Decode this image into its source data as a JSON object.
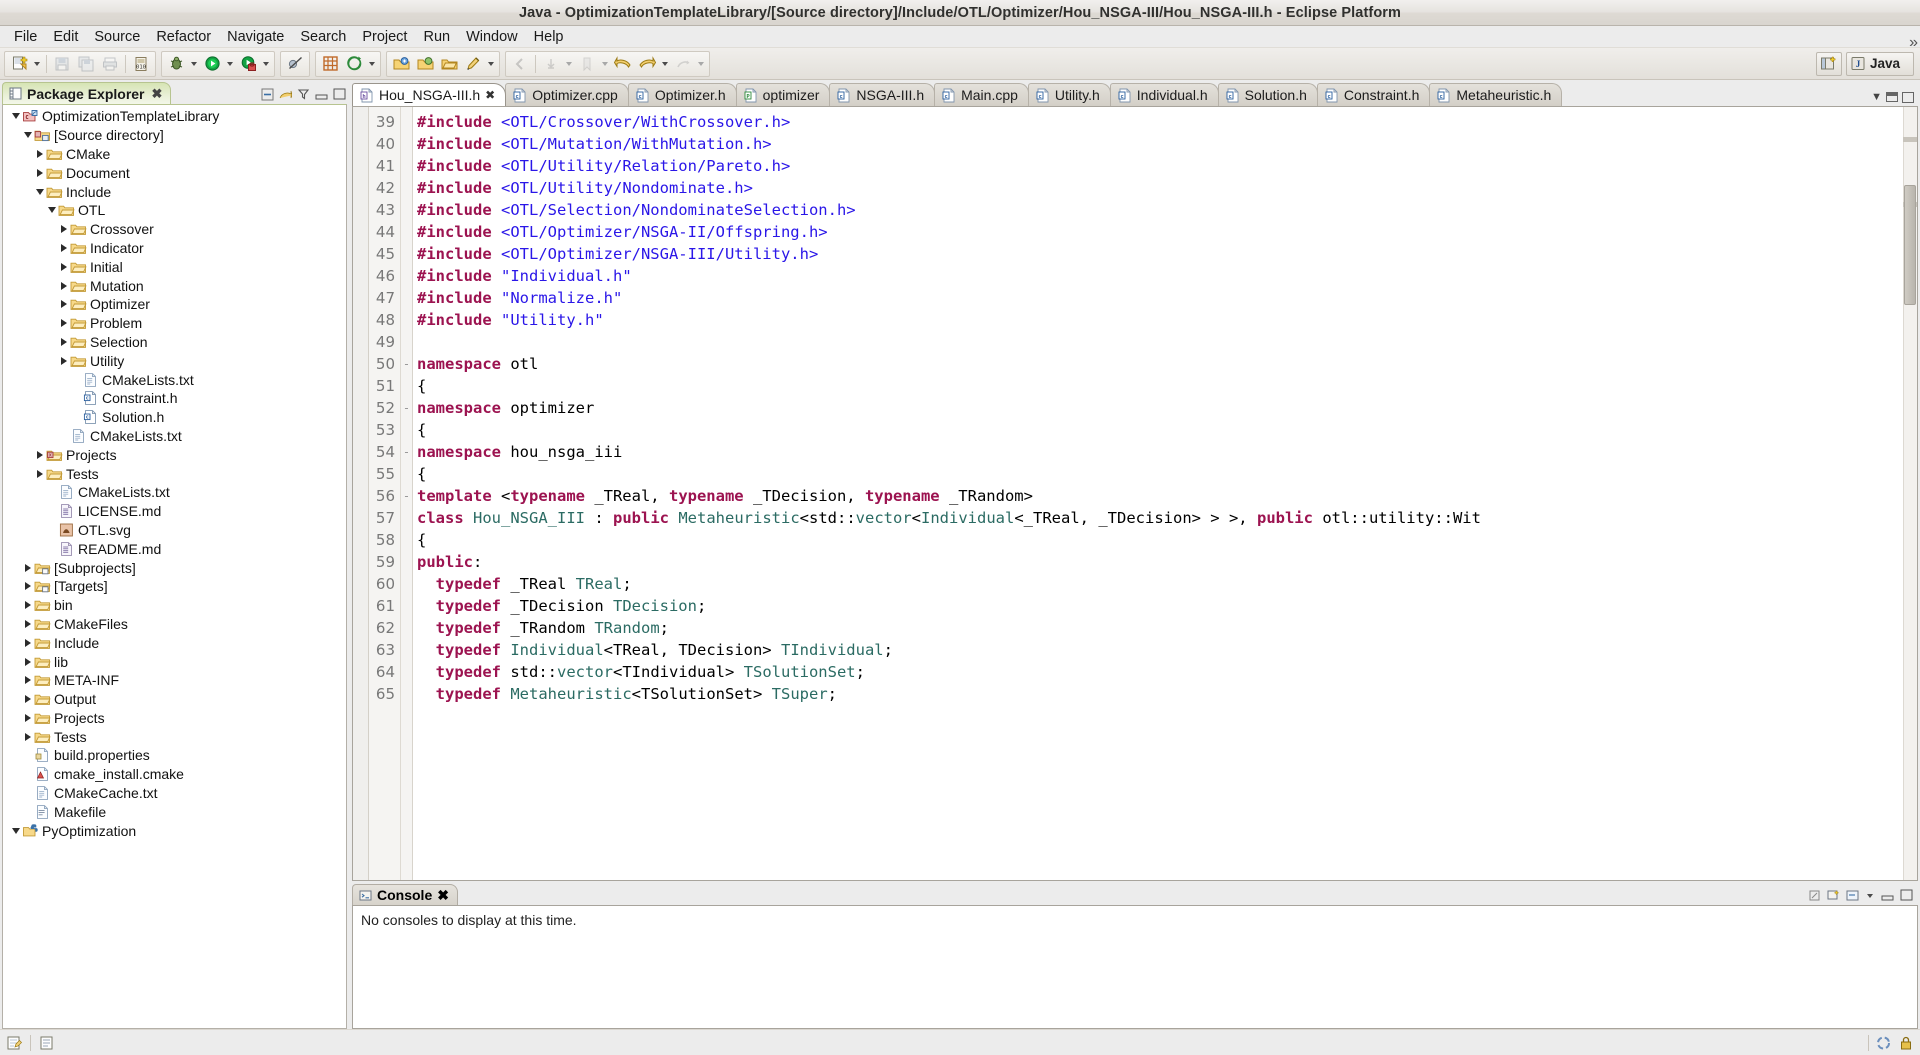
{
  "window": {
    "title": "Java - OptimizationTemplateLibrary/[Source directory]/Include/OTL/Optimizer/Hou_NSGA-III/Hou_NSGA-III.h - Eclipse Platform"
  },
  "menubar": {
    "items": [
      "File",
      "Edit",
      "Source",
      "Refactor",
      "Navigate",
      "Search",
      "Project",
      "Run",
      "Window",
      "Help"
    ]
  },
  "toolbar": {
    "perspective_label": "Java",
    "groups": [
      {
        "name": "file-group",
        "buttons": [
          "new-wizard-icon",
          "new-dropdown",
          "save-icon",
          "save-all-icon",
          "print-icon",
          "build-icon"
        ]
      },
      {
        "name": "debug-group",
        "buttons": [
          "debug-icon",
          "debug-dropdown",
          "run-icon",
          "run-dropdown",
          "external-tools-icon",
          "external-tools-dropdown"
        ]
      },
      {
        "name": "skip-group",
        "buttons": [
          "skip-breakpoints-icon"
        ]
      },
      {
        "name": "search-group",
        "buttons": [
          "new-class-icon",
          "search-icon",
          "search-dropdown"
        ]
      },
      {
        "name": "nav-group",
        "buttons": [
          "open-type-icon",
          "open-task-icon",
          "open-resource-icon",
          "marker-icon",
          "marker-dropdown"
        ]
      },
      {
        "name": "history-group",
        "buttons": [
          "prev-annotation-icon",
          "next-annotation-icon",
          "annotation-dropdown",
          "back-icon",
          "forward-icon",
          "forward-dropdown",
          "last-edit-icon",
          "last-edit-dropdown"
        ]
      }
    ]
  },
  "package_explorer": {
    "tab_label": "Package Explorer",
    "tools": [
      "collapse-all-icon",
      "link-editor-icon",
      "view-filter-icon",
      "minimize-icon",
      "maximize-icon"
    ],
    "tree": [
      {
        "label": "OptimizationTemplateLibrary",
        "indent": 0,
        "twisty": "down",
        "icon": "cproject-icon"
      },
      {
        "label": "[Source directory]",
        "indent": 1,
        "twisty": "down",
        "icon": "source-folder-icon"
      },
      {
        "label": "CMake",
        "indent": 2,
        "twisty": "right",
        "icon": "folder-icon"
      },
      {
        "label": "Document",
        "indent": 2,
        "twisty": "right",
        "icon": "folder-icon"
      },
      {
        "label": "Include",
        "indent": 2,
        "twisty": "down",
        "icon": "folder-icon"
      },
      {
        "label": "OTL",
        "indent": 3,
        "twisty": "down",
        "icon": "folder-icon"
      },
      {
        "label": "Crossover",
        "indent": 4,
        "twisty": "right",
        "icon": "folder-icon"
      },
      {
        "label": "Indicator",
        "indent": 4,
        "twisty": "right",
        "icon": "folder-icon"
      },
      {
        "label": "Initial",
        "indent": 4,
        "twisty": "right",
        "icon": "folder-icon"
      },
      {
        "label": "Mutation",
        "indent": 4,
        "twisty": "right",
        "icon": "folder-icon"
      },
      {
        "label": "Optimizer",
        "indent": 4,
        "twisty": "right",
        "icon": "folder-icon"
      },
      {
        "label": "Problem",
        "indent": 4,
        "twisty": "right",
        "icon": "folder-icon"
      },
      {
        "label": "Selection",
        "indent": 4,
        "twisty": "right",
        "icon": "folder-icon"
      },
      {
        "label": "Utility",
        "indent": 4,
        "twisty": "right",
        "icon": "folder-icon"
      },
      {
        "label": "CMakeLists.txt",
        "indent": 5,
        "twisty": "none",
        "icon": "text-file-icon"
      },
      {
        "label": "Constraint.h",
        "indent": 5,
        "twisty": "none",
        "icon": "c-header-icon"
      },
      {
        "label": "Solution.h",
        "indent": 5,
        "twisty": "none",
        "icon": "c-header-icon"
      },
      {
        "label": "CMakeLists.txt",
        "indent": 4,
        "twisty": "none",
        "icon": "text-file-icon"
      },
      {
        "label": "Projects",
        "indent": 2,
        "twisty": "right",
        "icon": "folder-red-icon"
      },
      {
        "label": "Tests",
        "indent": 2,
        "twisty": "right",
        "icon": "folder-icon"
      },
      {
        "label": "CMakeLists.txt",
        "indent": 3,
        "twisty": "none",
        "icon": "text-file-icon"
      },
      {
        "label": "LICENSE.md",
        "indent": 3,
        "twisty": "none",
        "icon": "md-file-icon"
      },
      {
        "label": "OTL.svg",
        "indent": 3,
        "twisty": "none",
        "icon": "svg-file-icon"
      },
      {
        "label": "README.md",
        "indent": 3,
        "twisty": "none",
        "icon": "md-file-icon"
      },
      {
        "label": "[Subprojects]",
        "indent": 1,
        "twisty": "right",
        "icon": "subproject-icon"
      },
      {
        "label": "[Targets]",
        "indent": 1,
        "twisty": "right",
        "icon": "subproject-icon"
      },
      {
        "label": "bin",
        "indent": 1,
        "twisty": "right",
        "icon": "folder-icon"
      },
      {
        "label": "CMakeFiles",
        "indent": 1,
        "twisty": "right",
        "icon": "folder-icon"
      },
      {
        "label": "Include",
        "indent": 1,
        "twisty": "right",
        "icon": "folder-icon"
      },
      {
        "label": "lib",
        "indent": 1,
        "twisty": "right",
        "icon": "folder-icon"
      },
      {
        "label": "META-INF",
        "indent": 1,
        "twisty": "right",
        "icon": "folder-icon"
      },
      {
        "label": "Output",
        "indent": 1,
        "twisty": "right",
        "icon": "folder-icon"
      },
      {
        "label": "Projects",
        "indent": 1,
        "twisty": "right",
        "icon": "folder-icon"
      },
      {
        "label": "Tests",
        "indent": 1,
        "twisty": "right",
        "icon": "folder-icon"
      },
      {
        "label": "build.properties",
        "indent": 1,
        "twisty": "none",
        "icon": "props-file-icon"
      },
      {
        "label": "cmake_install.cmake",
        "indent": 1,
        "twisty": "none",
        "icon": "cmake-file-icon"
      },
      {
        "label": "CMakeCache.txt",
        "indent": 1,
        "twisty": "none",
        "icon": "text-file-icon"
      },
      {
        "label": "Makefile",
        "indent": 1,
        "twisty": "none",
        "icon": "make-file-icon"
      },
      {
        "label": "PyOptimization",
        "indent": 0,
        "twisty": "down",
        "icon": "pyproject-icon"
      }
    ]
  },
  "editor": {
    "tabs": [
      {
        "label": "Hou_NSGA-III.h",
        "icon": "h-file-icon",
        "active": true,
        "closable": true
      },
      {
        "label": "Optimizer.cpp",
        "icon": "c-file-icon",
        "active": false,
        "closable": false
      },
      {
        "label": "Optimizer.h",
        "icon": "c-file-icon",
        "active": false,
        "closable": false
      },
      {
        "label": "optimizer",
        "icon": "py-file-icon",
        "active": false,
        "closable": false
      },
      {
        "label": "NSGA-III.h",
        "icon": "c-file-icon",
        "active": false,
        "closable": false
      },
      {
        "label": "Main.cpp",
        "icon": "c-file-icon",
        "active": false,
        "closable": false
      },
      {
        "label": "Utility.h",
        "icon": "c-file-icon",
        "active": false,
        "closable": false
      },
      {
        "label": "Individual.h",
        "icon": "c-file-icon",
        "active": false,
        "closable": false
      },
      {
        "label": "Solution.h",
        "icon": "c-file-icon",
        "active": false,
        "closable": false
      },
      {
        "label": "Constraint.h",
        "icon": "c-file-icon",
        "active": false,
        "closable": false
      },
      {
        "label": "Metaheuristic.h",
        "icon": "c-file-icon",
        "active": false,
        "closable": false
      }
    ],
    "first_line_number": 39,
    "lines": [
      {
        "n": 39,
        "fold": "",
        "tokens": [
          [
            "k",
            "#include"
          ],
          [
            "p",
            " "
          ],
          [
            "s",
            "<OTL/Crossover/WithCrossover.h>"
          ]
        ]
      },
      {
        "n": 40,
        "fold": "",
        "tokens": [
          [
            "k",
            "#include"
          ],
          [
            "p",
            " "
          ],
          [
            "s",
            "<OTL/Mutation/WithMutation.h>"
          ]
        ]
      },
      {
        "n": 41,
        "fold": "",
        "tokens": [
          [
            "k",
            "#include"
          ],
          [
            "p",
            " "
          ],
          [
            "s",
            "<OTL/Utility/Relation/Pareto.h>"
          ]
        ]
      },
      {
        "n": 42,
        "fold": "",
        "tokens": [
          [
            "k",
            "#include"
          ],
          [
            "p",
            " "
          ],
          [
            "s",
            "<OTL/Utility/Nondominate.h>"
          ]
        ]
      },
      {
        "n": 43,
        "fold": "",
        "tokens": [
          [
            "k",
            "#include"
          ],
          [
            "p",
            " "
          ],
          [
            "s",
            "<OTL/Selection/NondominateSelection.h>"
          ]
        ]
      },
      {
        "n": 44,
        "fold": "",
        "tokens": [
          [
            "k",
            "#include"
          ],
          [
            "p",
            " "
          ],
          [
            "s",
            "<OTL/Optimizer/NSGA-II/Offspring.h>"
          ]
        ]
      },
      {
        "n": 45,
        "fold": "",
        "tokens": [
          [
            "k",
            "#include"
          ],
          [
            "p",
            " "
          ],
          [
            "s",
            "<OTL/Optimizer/NSGA-III/Utility.h>"
          ]
        ]
      },
      {
        "n": 46,
        "fold": "",
        "tokens": [
          [
            "k",
            "#include"
          ],
          [
            "p",
            " "
          ],
          [
            "s",
            "\"Individual.h\""
          ]
        ]
      },
      {
        "n": 47,
        "fold": "",
        "tokens": [
          [
            "k",
            "#include"
          ],
          [
            "p",
            " "
          ],
          [
            "s",
            "\"Normalize.h\""
          ]
        ]
      },
      {
        "n": 48,
        "fold": "",
        "tokens": [
          [
            "k",
            "#include"
          ],
          [
            "p",
            " "
          ],
          [
            "s",
            "\"Utility.h\""
          ]
        ]
      },
      {
        "n": 49,
        "fold": "",
        "tokens": []
      },
      {
        "n": 50,
        "fold": "-",
        "tokens": [
          [
            "k",
            "namespace"
          ],
          [
            "p",
            " otl"
          ]
        ]
      },
      {
        "n": 51,
        "fold": "",
        "tokens": [
          [
            "p",
            "{"
          ]
        ]
      },
      {
        "n": 52,
        "fold": "-",
        "tokens": [
          [
            "k",
            "namespace"
          ],
          [
            "p",
            " optimizer"
          ]
        ]
      },
      {
        "n": 53,
        "fold": "",
        "tokens": [
          [
            "p",
            "{"
          ]
        ]
      },
      {
        "n": 54,
        "fold": "-",
        "tokens": [
          [
            "k",
            "namespace"
          ],
          [
            "p",
            " hou_nsga_iii"
          ]
        ]
      },
      {
        "n": 55,
        "fold": "",
        "tokens": [
          [
            "p",
            "{"
          ]
        ]
      },
      {
        "n": 56,
        "fold": "-",
        "tokens": [
          [
            "k",
            "template"
          ],
          [
            "p",
            " <"
          ],
          [
            "k",
            "typename"
          ],
          [
            "p",
            " _TReal, "
          ],
          [
            "k",
            "typename"
          ],
          [
            "p",
            " _TDecision, "
          ],
          [
            "k",
            "typename"
          ],
          [
            "p",
            " _TRandom>"
          ]
        ]
      },
      {
        "n": 57,
        "fold": "",
        "tokens": [
          [
            "k",
            "class"
          ],
          [
            "p",
            " "
          ],
          [
            "t",
            "Hou_NSGA_III"
          ],
          [
            "p",
            " : "
          ],
          [
            "k",
            "public"
          ],
          [
            "p",
            " "
          ],
          [
            "t",
            "Metaheuristic"
          ],
          [
            "p",
            "<std::"
          ],
          [
            "t",
            "vector"
          ],
          [
            "p",
            "<"
          ],
          [
            "t",
            "Individual"
          ],
          [
            "p",
            "<_TReal, _TDecision> > >, "
          ],
          [
            "k",
            "public"
          ],
          [
            "p",
            " otl::utility::Wit"
          ]
        ]
      },
      {
        "n": 58,
        "fold": "",
        "tokens": [
          [
            "p",
            "{"
          ]
        ]
      },
      {
        "n": 59,
        "fold": "",
        "tokens": [
          [
            "k",
            "public"
          ],
          [
            "p",
            ":"
          ]
        ]
      },
      {
        "n": 60,
        "fold": "",
        "tokens": [
          [
            "p",
            "  "
          ],
          [
            "k",
            "typedef"
          ],
          [
            "p",
            " _TReal "
          ],
          [
            "t",
            "TReal"
          ],
          [
            "p",
            ";"
          ]
        ]
      },
      {
        "n": 61,
        "fold": "",
        "tokens": [
          [
            "p",
            "  "
          ],
          [
            "k",
            "typedef"
          ],
          [
            "p",
            " _TDecision "
          ],
          [
            "t",
            "TDecision"
          ],
          [
            "p",
            ";"
          ]
        ]
      },
      {
        "n": 62,
        "fold": "",
        "tokens": [
          [
            "p",
            "  "
          ],
          [
            "k",
            "typedef"
          ],
          [
            "p",
            " _TRandom "
          ],
          [
            "t",
            "TRandom"
          ],
          [
            "p",
            ";"
          ]
        ]
      },
      {
        "n": 63,
        "fold": "",
        "tokens": [
          [
            "p",
            "  "
          ],
          [
            "k",
            "typedef"
          ],
          [
            "p",
            " "
          ],
          [
            "t",
            "Individual"
          ],
          [
            "p",
            "<TReal, TDecision> "
          ],
          [
            "t",
            "TIndividual"
          ],
          [
            "p",
            ";"
          ]
        ]
      },
      {
        "n": 64,
        "fold": "",
        "tokens": [
          [
            "p",
            "  "
          ],
          [
            "k",
            "typedef"
          ],
          [
            "p",
            " std::"
          ],
          [
            "t",
            "vector"
          ],
          [
            "p",
            "<TIndividual> "
          ],
          [
            "t",
            "TSolutionSet"
          ],
          [
            "p",
            ";"
          ]
        ]
      },
      {
        "n": 65,
        "fold": "",
        "tokens": [
          [
            "p",
            "  "
          ],
          [
            "k",
            "typedef"
          ],
          [
            "p",
            " "
          ],
          [
            "t",
            "Metaheuristic"
          ],
          [
            "p",
            "<TSolutionSet> "
          ],
          [
            "t",
            "TSuper"
          ],
          [
            "p",
            ";"
          ]
        ]
      }
    ]
  },
  "console": {
    "tab_label": "Console",
    "message": "No consoles to display at this time.",
    "tools": [
      "pin-icon",
      "new-console-icon",
      "open-console-dropdown",
      "minimize-icon",
      "maximize-icon"
    ]
  },
  "statusbar": {
    "left_icons": [
      "writable-icon",
      "insert-mode-icon"
    ],
    "right_icons": [
      "progress-icon",
      "lock-icon"
    ]
  }
}
